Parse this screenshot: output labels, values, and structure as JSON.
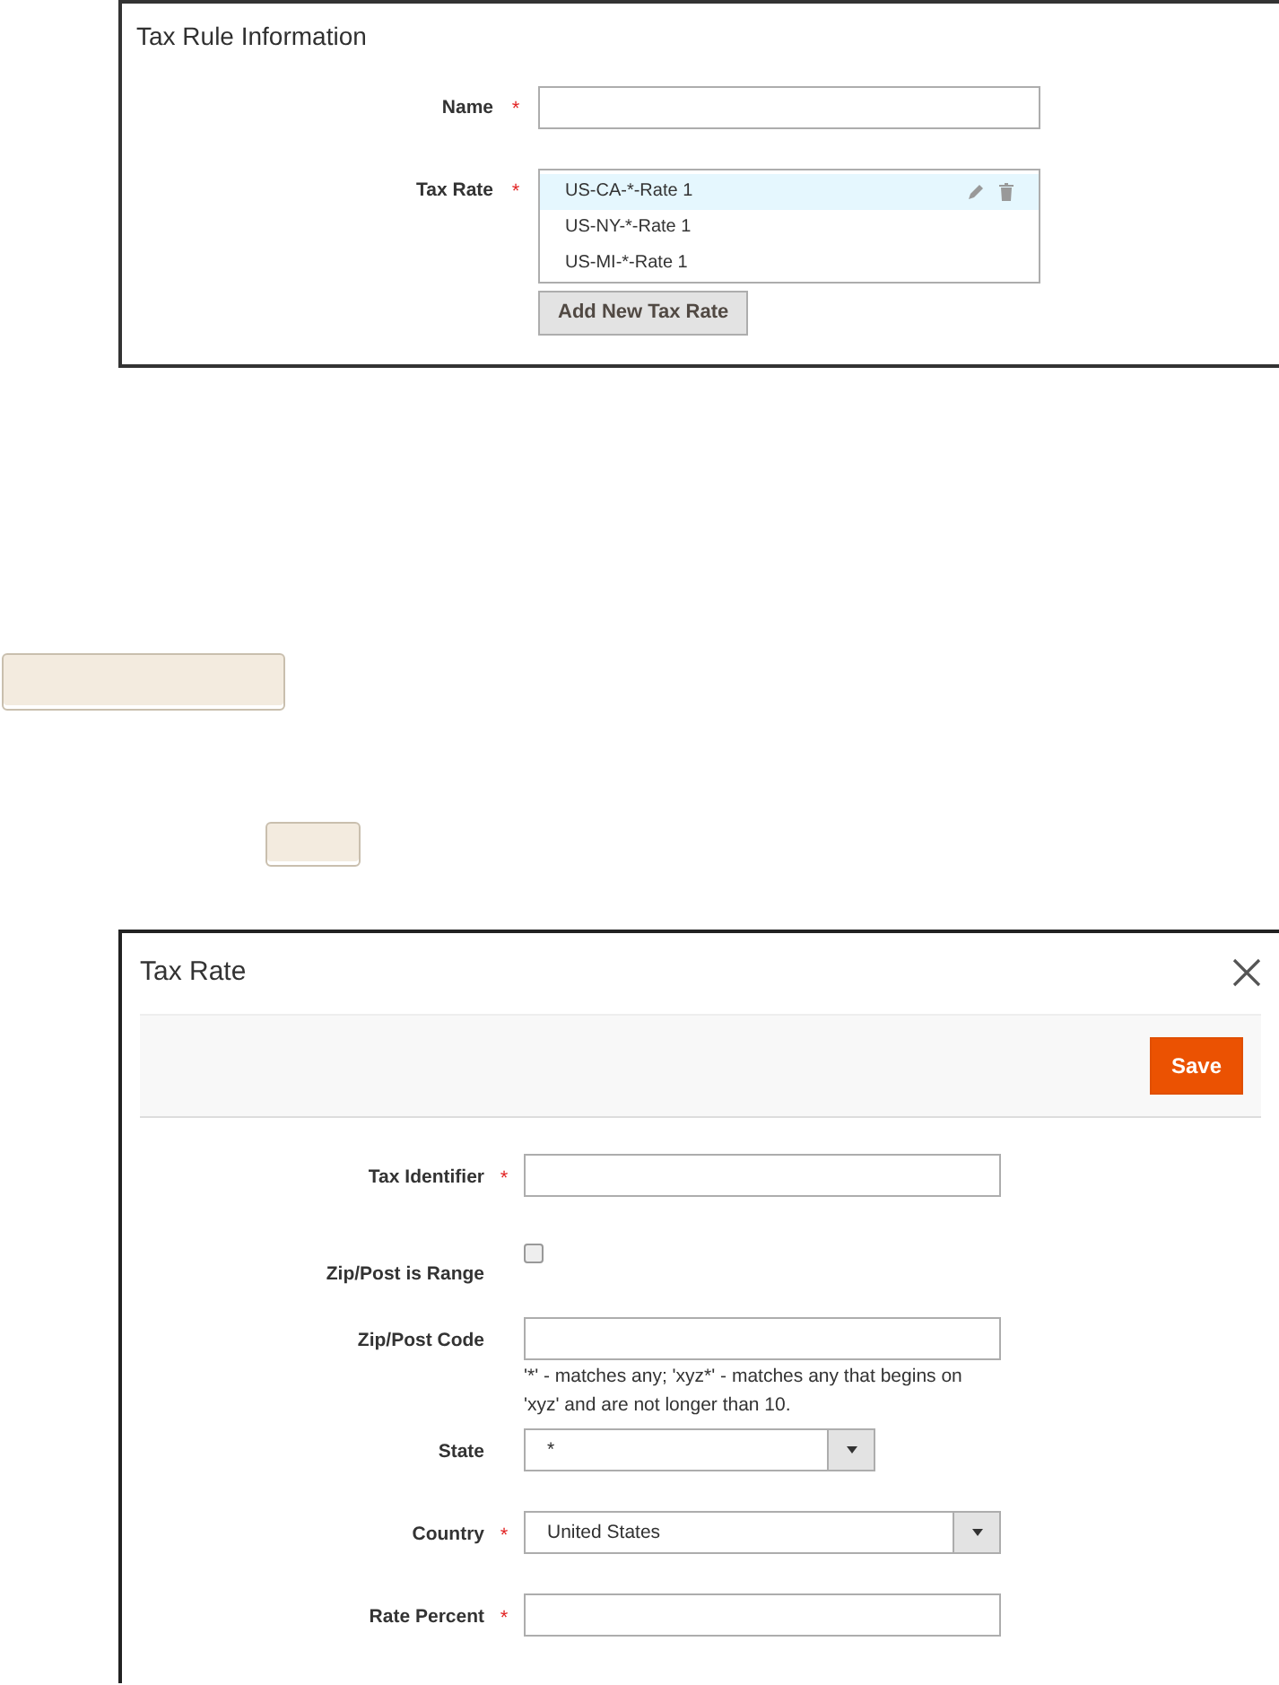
{
  "tax_rule": {
    "title": "Tax Rule Information",
    "name_field": {
      "label": "Name",
      "required": true
    },
    "tax_rate_field": {
      "label": "Tax Rate",
      "required": true,
      "rates": [
        {
          "label": "US-CA-*-Rate 1",
          "selected": true
        },
        {
          "label": "US-NY-*-Rate 1",
          "selected": false
        },
        {
          "label": "US-MI-*-Rate 1",
          "selected": false
        }
      ],
      "button": "Add New Tax Rate"
    }
  },
  "dialog": {
    "title": "Tax Rate",
    "save": "Save",
    "fields": [
      {
        "kind": "text",
        "label": "Tax Identifier",
        "required": true
      },
      {
        "kind": "checkbox",
        "label": "Zip/Post is Range",
        "required": false,
        "checked": false
      },
      {
        "kind": "text",
        "label": "Zip/Post Code",
        "required": false,
        "note": "'*' - matches any; 'xyz*' - matches any that begins on 'xyz' and are not longer than 10."
      },
      {
        "kind": "short_select",
        "label": "State",
        "required": false,
        "value": "*"
      },
      {
        "kind": "select",
        "label": "Country",
        "required": true,
        "value": "United States"
      },
      {
        "kind": "text",
        "label": "Rate Percent",
        "required": true
      }
    ]
  }
}
